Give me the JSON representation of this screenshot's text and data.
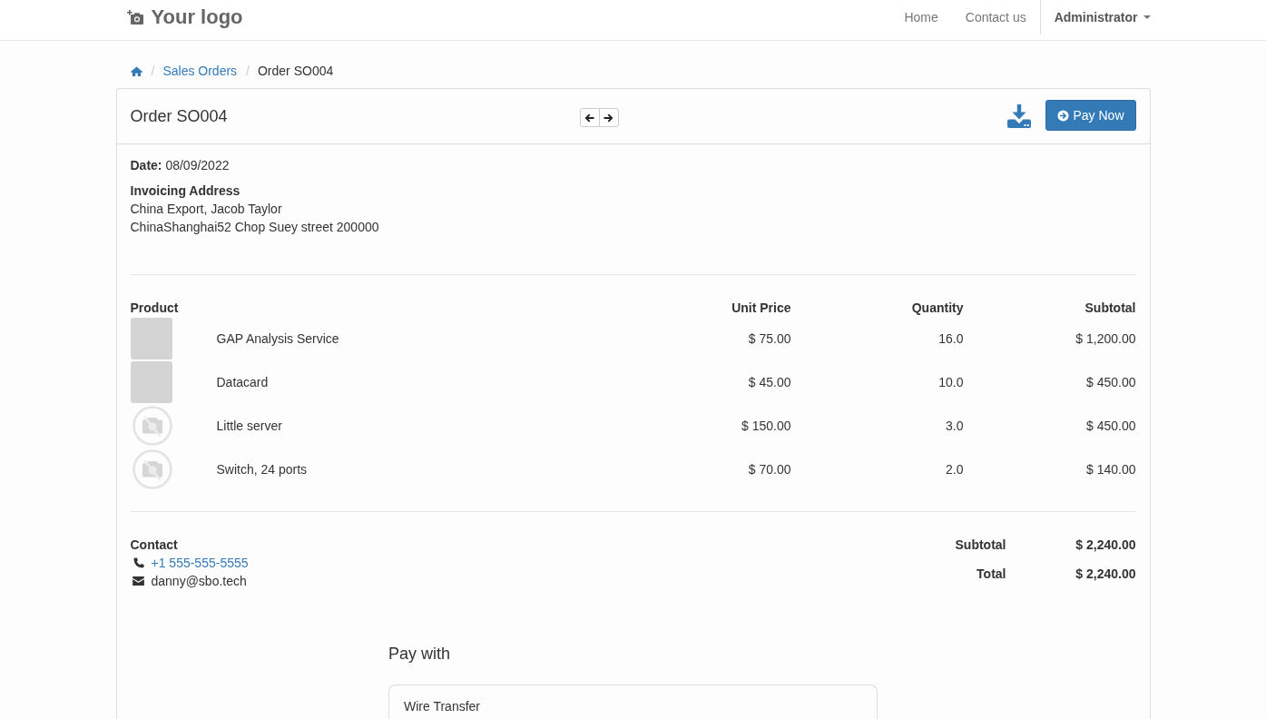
{
  "navbar": {
    "logo": "Your logo",
    "links": [
      {
        "label": "Home"
      },
      {
        "label": "Contact us"
      }
    ],
    "user_menu": "Administrator"
  },
  "breadcrumb": [
    {
      "kind": "home"
    },
    {
      "kind": "link",
      "separator": "/",
      "label": "Sales Orders"
    },
    {
      "kind": "current",
      "separator": "/",
      "label": "Order SO004"
    }
  ],
  "order": {
    "title": "Order SO004",
    "pay_button": "Pay Now",
    "date": "**Date:** 08/09/2022",
    "address_label": "Invoicing Address",
    "address_lines": [
      "China Export, Jacob Taylor",
      "ChinaShanghai52 Chop Suey street 200000"
    ]
  },
  "table": {
    "columns": [
      "Product",
      "Unit Price",
      "Quantity",
      "Subtotal"
    ],
    "rows": [
      {
        "kind": "photo",
        "product": "GAP Analysis Service",
        "unit_price": "$ 75.00",
        "quantity": "16.0",
        "subtotal": "$ 1,200.00"
      },
      {
        "kind": "photo",
        "product": "Datacard",
        "unit_price": "$ 45.00",
        "quantity": "10.0",
        "subtotal": "$ 450.00"
      },
      {
        "kind": "no-image",
        "product": "Little server",
        "unit_price": "$ 150.00",
        "quantity": "3.0",
        "subtotal": "$ 450.00"
      },
      {
        "kind": "no-image",
        "product": "Switch, 24 ports",
        "unit_price": "$ 70.00",
        "quantity": "2.0",
        "subtotal": "$ 140.00"
      }
    ]
  },
  "contact": {
    "label": "Contact",
    "phone": "+1 555-555-5555",
    "email": "danny@sbo.tech"
  },
  "totals": [
    {
      "label": "Subtotal",
      "value": "$ 2,240.00"
    },
    {
      "label": "Total",
      "value": "$ 2,240.00"
    }
  ],
  "payment": {
    "heading": "Pay with",
    "methods": [
      {
        "label": "Wire Transfer"
      }
    ]
  }
}
